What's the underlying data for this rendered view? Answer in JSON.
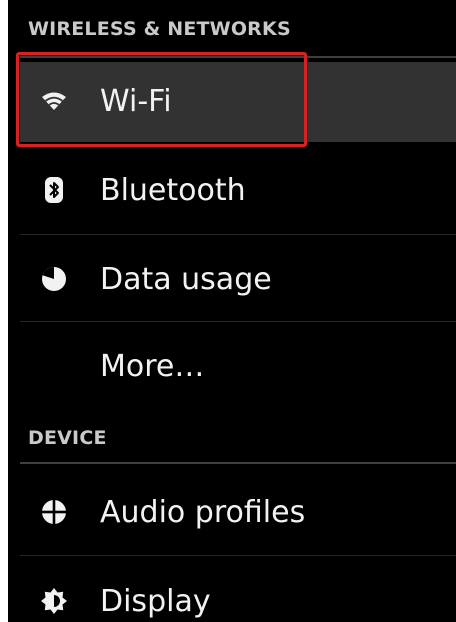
{
  "sections": [
    {
      "header": "WIRELESS & NETWORKS",
      "items": [
        {
          "label": "Wi-Fi",
          "icon": "wifi-icon",
          "selected": true
        },
        {
          "label": "Bluetooth",
          "icon": "bluetooth-icon"
        },
        {
          "label": "Data usage",
          "icon": "data-usage-icon"
        },
        {
          "label": "More…",
          "icon": null
        }
      ]
    },
    {
      "header": "DEVICE",
      "items": [
        {
          "label": "Audio profiles",
          "icon": "audio-profiles-icon"
        },
        {
          "label": "Display",
          "icon": "display-icon"
        }
      ]
    }
  ],
  "colors": {
    "background": "#000000",
    "text": "#f2f2f2",
    "header_text": "#c9c9c9",
    "selected_row": "#323232",
    "highlight_border": "#d82121"
  }
}
